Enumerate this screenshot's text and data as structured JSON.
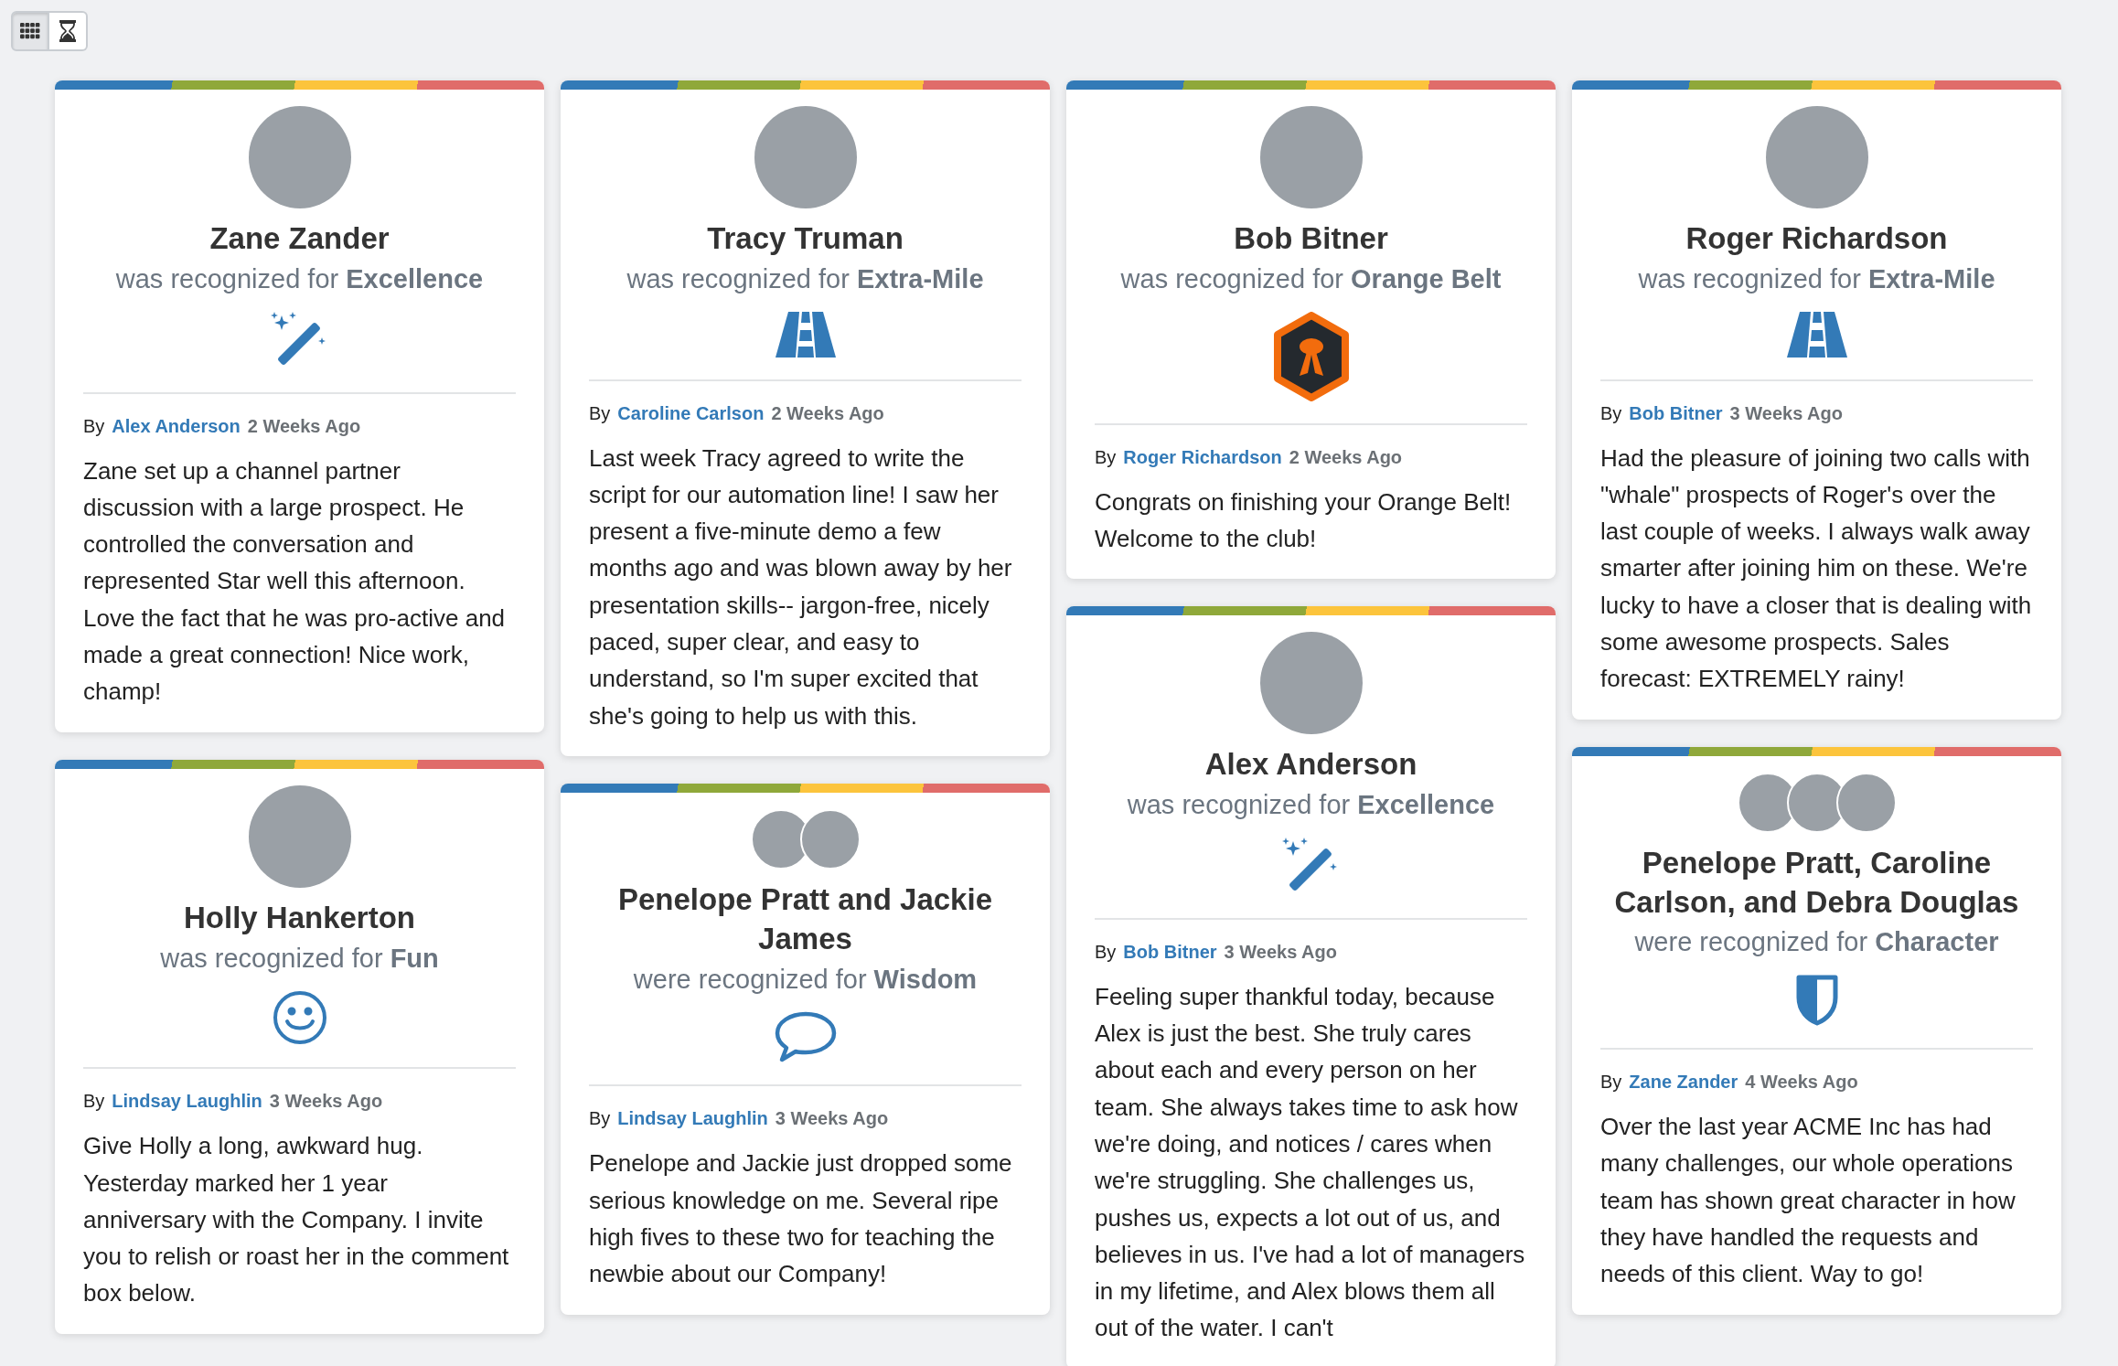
{
  "view_toggle": [
    {
      "kind": "grid",
      "selected": true
    },
    {
      "kind": "hourglass",
      "selected": false
    }
  ],
  "columns": [
    {
      "cards": [
        {
          "avatars": [
            {
              "kind": "photo"
            }
          ],
          "recipients": "Zane Zander",
          "recognition": "was recognized for **Excellence**",
          "award": {
            "kind": "wand"
          },
          "by_label": "By",
          "author": "Alex Anderson",
          "time": "2 Weeks Ago",
          "message": "Zane set up a channel partner discussion with a large prospect. He controlled the conversation and represented Star well this afternoon. Love the fact that he was pro-active and made a great connection! Nice work, champ!"
        },
        {
          "avatars": [
            {
              "kind": "photo"
            }
          ],
          "recipients": "Holly Hankerton",
          "recognition": "was recognized for **Fun**",
          "award": {
            "kind": "smiley"
          },
          "by_label": "By",
          "author": "Lindsay Laughlin",
          "time": "3 Weeks Ago",
          "message": "Give Holly a long, awkward hug. Yesterday marked her 1 year anniversary with the Company. I invite you to relish or roast her in the comment box below."
        }
      ]
    },
    {
      "cards": [
        {
          "avatars": [
            {
              "kind": "photo"
            }
          ],
          "recipients": "Tracy Truman",
          "recognition": "was recognized for **Extra-Mile**",
          "award": {
            "kind": "road"
          },
          "by_label": "By",
          "author": "Caroline Carlson",
          "time": "2 Weeks Ago",
          "message": "Last week Tracy agreed to write the script for our automation line! I saw her present a five-minute demo a few months ago and was blown away by her presentation skills-- jargon-free, nicely paced, super clear, and easy to understand, so I'm super excited that she's going to help us with this."
        },
        {
          "avatars": [
            {
              "kind": "photo"
            },
            {
              "kind": "photo"
            }
          ],
          "recipients": "Penelope Pratt and Jackie James",
          "recognition": "were recognized for **Wisdom**",
          "award": {
            "kind": "speech"
          },
          "by_label": "By",
          "author": "Lindsay Laughlin",
          "time": "3 Weeks Ago",
          "message": "Penelope and Jackie just dropped some serious knowledge on me. Several ripe high fives to these two for teaching the newbie about our Company!"
        }
      ]
    },
    {
      "cards": [
        {
          "avatars": [
            {
              "kind": "photo"
            }
          ],
          "recipients": "Bob Bitner",
          "recognition": "was recognized for **Orange Belt**",
          "award": {
            "kind": "belt"
          },
          "by_label": "By",
          "author": "Roger Richardson",
          "time": "2 Weeks Ago",
          "message": "Congrats on finishing your Orange Belt! Welcome to the club!"
        },
        {
          "avatars": [
            {
              "kind": "photo"
            }
          ],
          "recipients": "Alex Anderson",
          "recognition": "was recognized for **Excellence**",
          "award": {
            "kind": "wand"
          },
          "by_label": "By",
          "author": "Bob Bitner",
          "time": "3 Weeks Ago",
          "message": "Feeling super thankful today, because Alex is just the best. She truly cares about each and every person on her team. She always takes time to ask how we're doing, and notices / cares when we're struggling. She challenges us, pushes us, expects a lot out of us, and believes in us. I've had a lot of managers in my lifetime, and Alex blows them all out of the water. I can't"
        }
      ]
    },
    {
      "cards": [
        {
          "avatars": [
            {
              "kind": "photo"
            }
          ],
          "recipients": "Roger Richardson",
          "recognition": "was recognized for **Extra-Mile**",
          "award": {
            "kind": "road"
          },
          "by_label": "By",
          "author": "Bob Bitner",
          "time": "3 Weeks Ago",
          "message": "Had the pleasure of joining two calls with \"whale\" prospects of Roger's over the last couple of weeks. I always walk away smarter after joining him on these. We're lucky to have a closer that is dealing with some awesome prospects. Sales forecast: EXTREMELY rainy!"
        },
        {
          "avatars": [
            {
              "kind": "photo"
            },
            {
              "kind": "photo"
            },
            {
              "kind": "photo"
            }
          ],
          "recipients": "Penelope Pratt, Caroline Carlson, and Debra Douglas",
          "recognition": "were recognized for **Character**",
          "award": {
            "kind": "shield"
          },
          "by_label": "By",
          "author": "Zane Zander",
          "time": "4 Weeks Ago",
          "message": "Over the last year ACME Inc has had many challenges, our whole operations team has shown great character in how they have handled the requests and needs of this client. Way to go!"
        }
      ]
    }
  ]
}
